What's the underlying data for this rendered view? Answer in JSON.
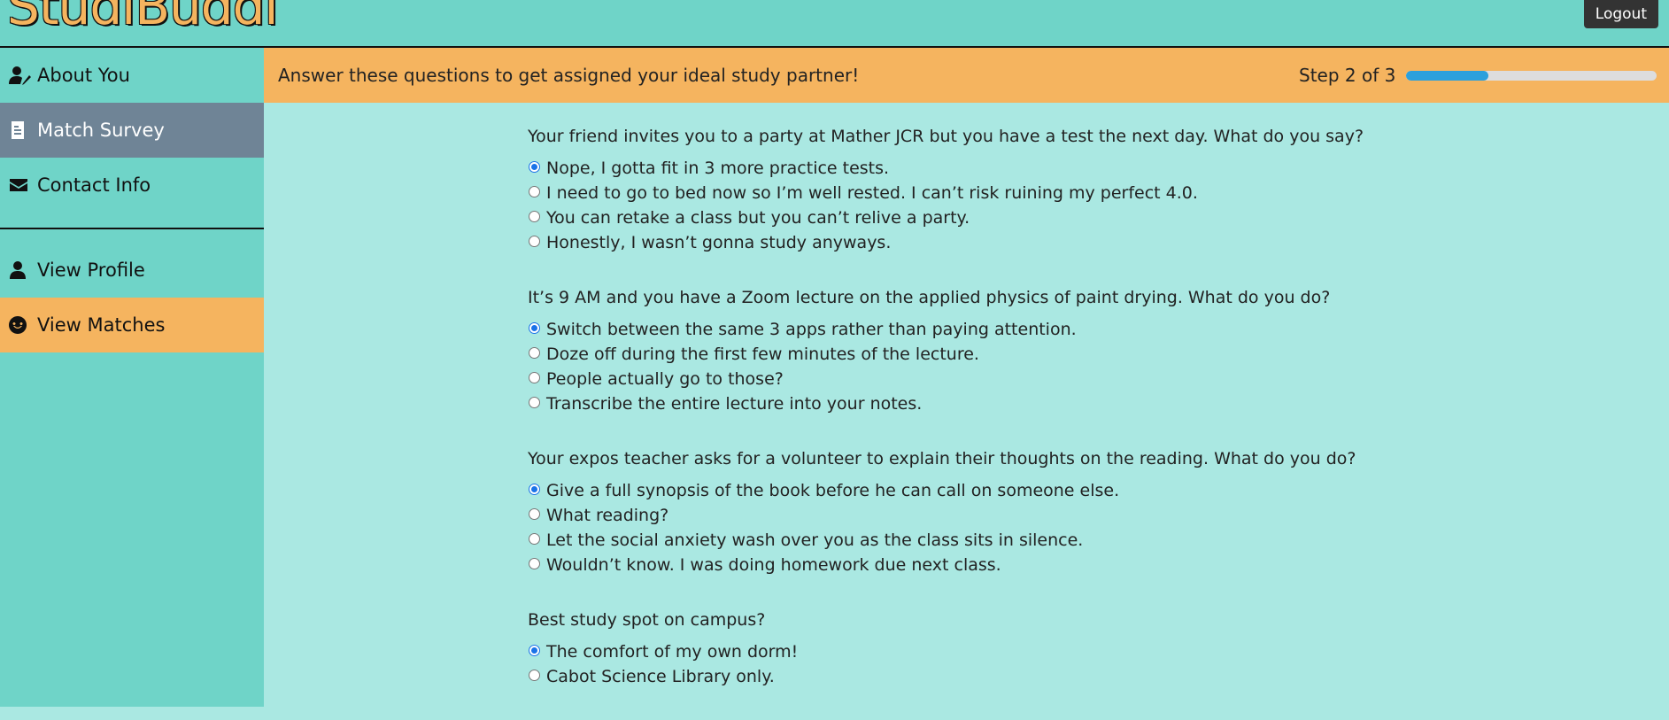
{
  "header": {
    "logo": "StudiBuddi",
    "logout_label": "Logout"
  },
  "sidebar": {
    "items": [
      {
        "label": "About You",
        "icon": "user-edit-icon"
      },
      {
        "label": "Match Survey",
        "icon": "file-alt-icon"
      },
      {
        "label": "Contact Info",
        "icon": "envelope-icon"
      },
      {
        "label": "View Profile",
        "icon": "user-icon"
      },
      {
        "label": "View Matches",
        "icon": "smile-icon"
      }
    ],
    "active": "Match Survey"
  },
  "banner": {
    "text": "Answer these questions to get assigned your ideal study partner!",
    "step": "Step 2 of 3",
    "progress": 0.33
  },
  "questions": [
    {
      "text": "Your friend invites you to a party at Mather JCR but you have a test the next day. What do you say?",
      "options": [
        "Nope, I gotta fit in 3 more practice tests.",
        "I need to go to bed now so I’m well rested. I can’t risk ruining my perfect 4.0.",
        "You can retake a class but you can’t relive a party.",
        "Honestly, I wasn’t gonna study anyways."
      ],
      "selected": 0
    },
    {
      "text": "It’s 9 AM and you have a Zoom lecture on the applied physics of paint drying. What do you do?",
      "options": [
        "Switch between the same 3 apps rather than paying attention.",
        "Doze off during the first few minutes of the lecture.",
        "People actually go to those?",
        "Transcribe the entire lecture into your notes."
      ],
      "selected": 0
    },
    {
      "text": "Your expos teacher asks for a volunteer to explain their thoughts on the reading. What do you do?",
      "options": [
        "Give a full synopsis of the book before he can call on someone else.",
        "What reading?",
        "Let the social anxiety wash over you as the class sits in silence.",
        "Wouldn’t know. I was doing homework due next class."
      ],
      "selected": 0
    },
    {
      "text": "Best study spot on campus?",
      "options": [
        "The comfort of my own dorm!",
        "Cabot Science Library only."
      ],
      "selected": 0
    }
  ],
  "colors": {
    "teal": "#6fd4c8",
    "light_teal": "#aae8e2",
    "orange": "#f5b45f",
    "slate": "#6f8496",
    "progress_blue": "#2ba0dc"
  }
}
